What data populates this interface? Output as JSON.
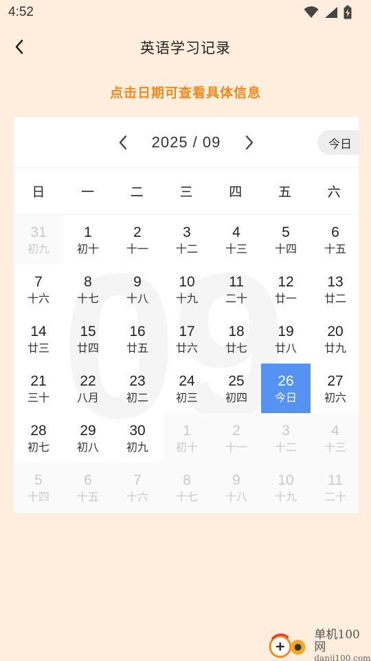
{
  "status": {
    "time": "4:52"
  },
  "app_bar": {
    "title": "英语学习记录"
  },
  "hint": "点击日期可查看具体信息",
  "calendar": {
    "month_label": "2025 / 09",
    "today_label": "今日",
    "weekdays": [
      "日",
      "一",
      "二",
      "三",
      "四",
      "五",
      "六"
    ],
    "watermark": "09",
    "days": [
      {
        "num": "31",
        "lunar": "初九",
        "muted": true
      },
      {
        "num": "1",
        "lunar": "初十"
      },
      {
        "num": "2",
        "lunar": "十一"
      },
      {
        "num": "3",
        "lunar": "十二"
      },
      {
        "num": "4",
        "lunar": "十三"
      },
      {
        "num": "5",
        "lunar": "十四"
      },
      {
        "num": "6",
        "lunar": "十五"
      },
      {
        "num": "7",
        "lunar": "十六"
      },
      {
        "num": "8",
        "lunar": "十七"
      },
      {
        "num": "9",
        "lunar": "十八"
      },
      {
        "num": "10",
        "lunar": "十九"
      },
      {
        "num": "11",
        "lunar": "二十"
      },
      {
        "num": "12",
        "lunar": "廿一"
      },
      {
        "num": "13",
        "lunar": "廿二"
      },
      {
        "num": "14",
        "lunar": "廿三"
      },
      {
        "num": "15",
        "lunar": "廿四"
      },
      {
        "num": "16",
        "lunar": "廿五"
      },
      {
        "num": "17",
        "lunar": "廿六"
      },
      {
        "num": "18",
        "lunar": "廿七"
      },
      {
        "num": "19",
        "lunar": "廿八"
      },
      {
        "num": "20",
        "lunar": "廿九"
      },
      {
        "num": "21",
        "lunar": "三十"
      },
      {
        "num": "22",
        "lunar": "八月"
      },
      {
        "num": "23",
        "lunar": "初二"
      },
      {
        "num": "24",
        "lunar": "初三"
      },
      {
        "num": "25",
        "lunar": "初四"
      },
      {
        "num": "26",
        "lunar": "今日",
        "selected": true
      },
      {
        "num": "27",
        "lunar": "初六"
      },
      {
        "num": "28",
        "lunar": "初七"
      },
      {
        "num": "29",
        "lunar": "初八"
      },
      {
        "num": "30",
        "lunar": "初九"
      },
      {
        "num": "1",
        "lunar": "初十",
        "muted": true
      },
      {
        "num": "2",
        "lunar": "十一",
        "muted": true
      },
      {
        "num": "3",
        "lunar": "十二",
        "muted": true
      },
      {
        "num": "4",
        "lunar": "十三",
        "muted": true
      },
      {
        "num": "5",
        "lunar": "十四",
        "muted": true
      },
      {
        "num": "6",
        "lunar": "十五",
        "muted": true
      },
      {
        "num": "7",
        "lunar": "十六",
        "muted": true
      },
      {
        "num": "8",
        "lunar": "十七",
        "muted": true
      },
      {
        "num": "9",
        "lunar": "十八",
        "muted": true
      },
      {
        "num": "10",
        "lunar": "十九",
        "muted": true
      },
      {
        "num": "11",
        "lunar": "二十",
        "muted": true
      }
    ]
  },
  "site_logo": {
    "name": "单机100网",
    "url": "danji100.com"
  },
  "colors": {
    "background": "#FFEEDD",
    "accent": "#F08A1C",
    "selected": "#5592F2"
  }
}
